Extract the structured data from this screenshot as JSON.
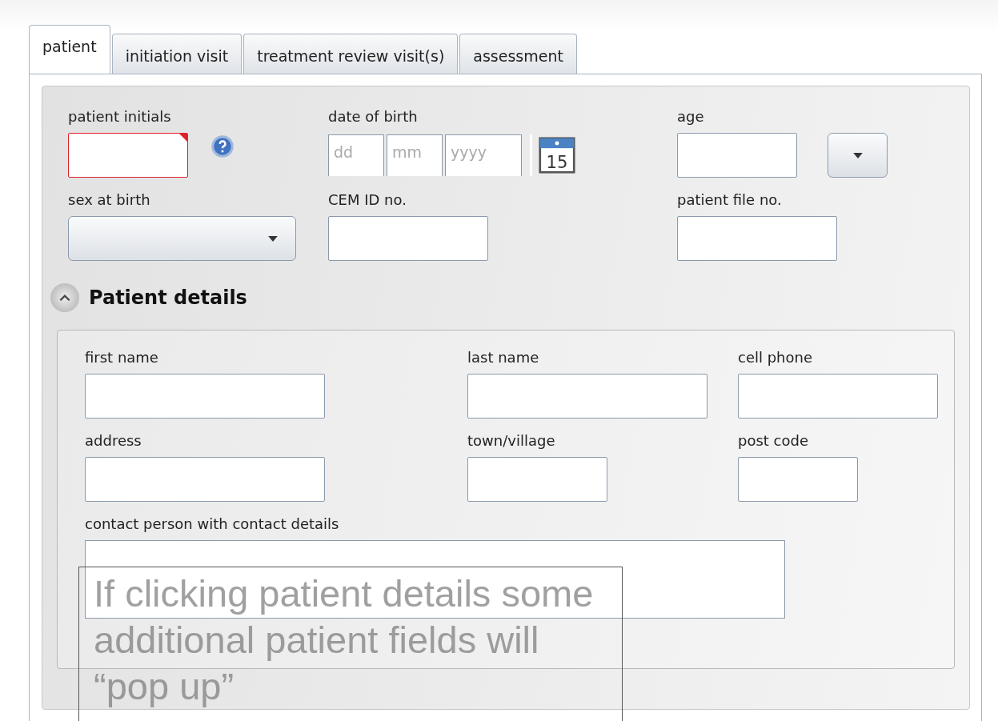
{
  "tabs": [
    {
      "label": "patient",
      "selected": true
    },
    {
      "label": "initiation visit",
      "selected": false
    },
    {
      "label": "treatment review visit(s)",
      "selected": false
    },
    {
      "label": "assessment",
      "selected": false
    }
  ],
  "fields": [
    {
      "label": "patient initials",
      "kind": "text",
      "invalid": true,
      "help": true
    },
    {
      "label": "date of birth",
      "kind": "date",
      "placeholders": [
        "dd",
        "mm",
        "yyyy"
      ],
      "calendar_day": "15"
    },
    {
      "label": "age",
      "kind": "text-dropdown"
    },
    {
      "label": "sex at birth",
      "kind": "select"
    },
    {
      "label": "CEM ID no.",
      "kind": "text"
    },
    {
      "label": "patient file no.",
      "kind": "text"
    }
  ],
  "details": {
    "title": "Patient details",
    "expanded": true,
    "fields": [
      {
        "label": "first name",
        "kind": "text"
      },
      {
        "label": "last name",
        "kind": "text"
      },
      {
        "label": "cell phone",
        "kind": "text"
      },
      {
        "label": "address",
        "kind": "text"
      },
      {
        "label": "town/village",
        "kind": "text"
      },
      {
        "label": "post code",
        "kind": "text"
      },
      {
        "label": "contact person with contact details",
        "kind": "textarea"
      }
    ]
  },
  "note": {
    "text": "If clicking patient details some additional patient fields will “pop up”"
  }
}
